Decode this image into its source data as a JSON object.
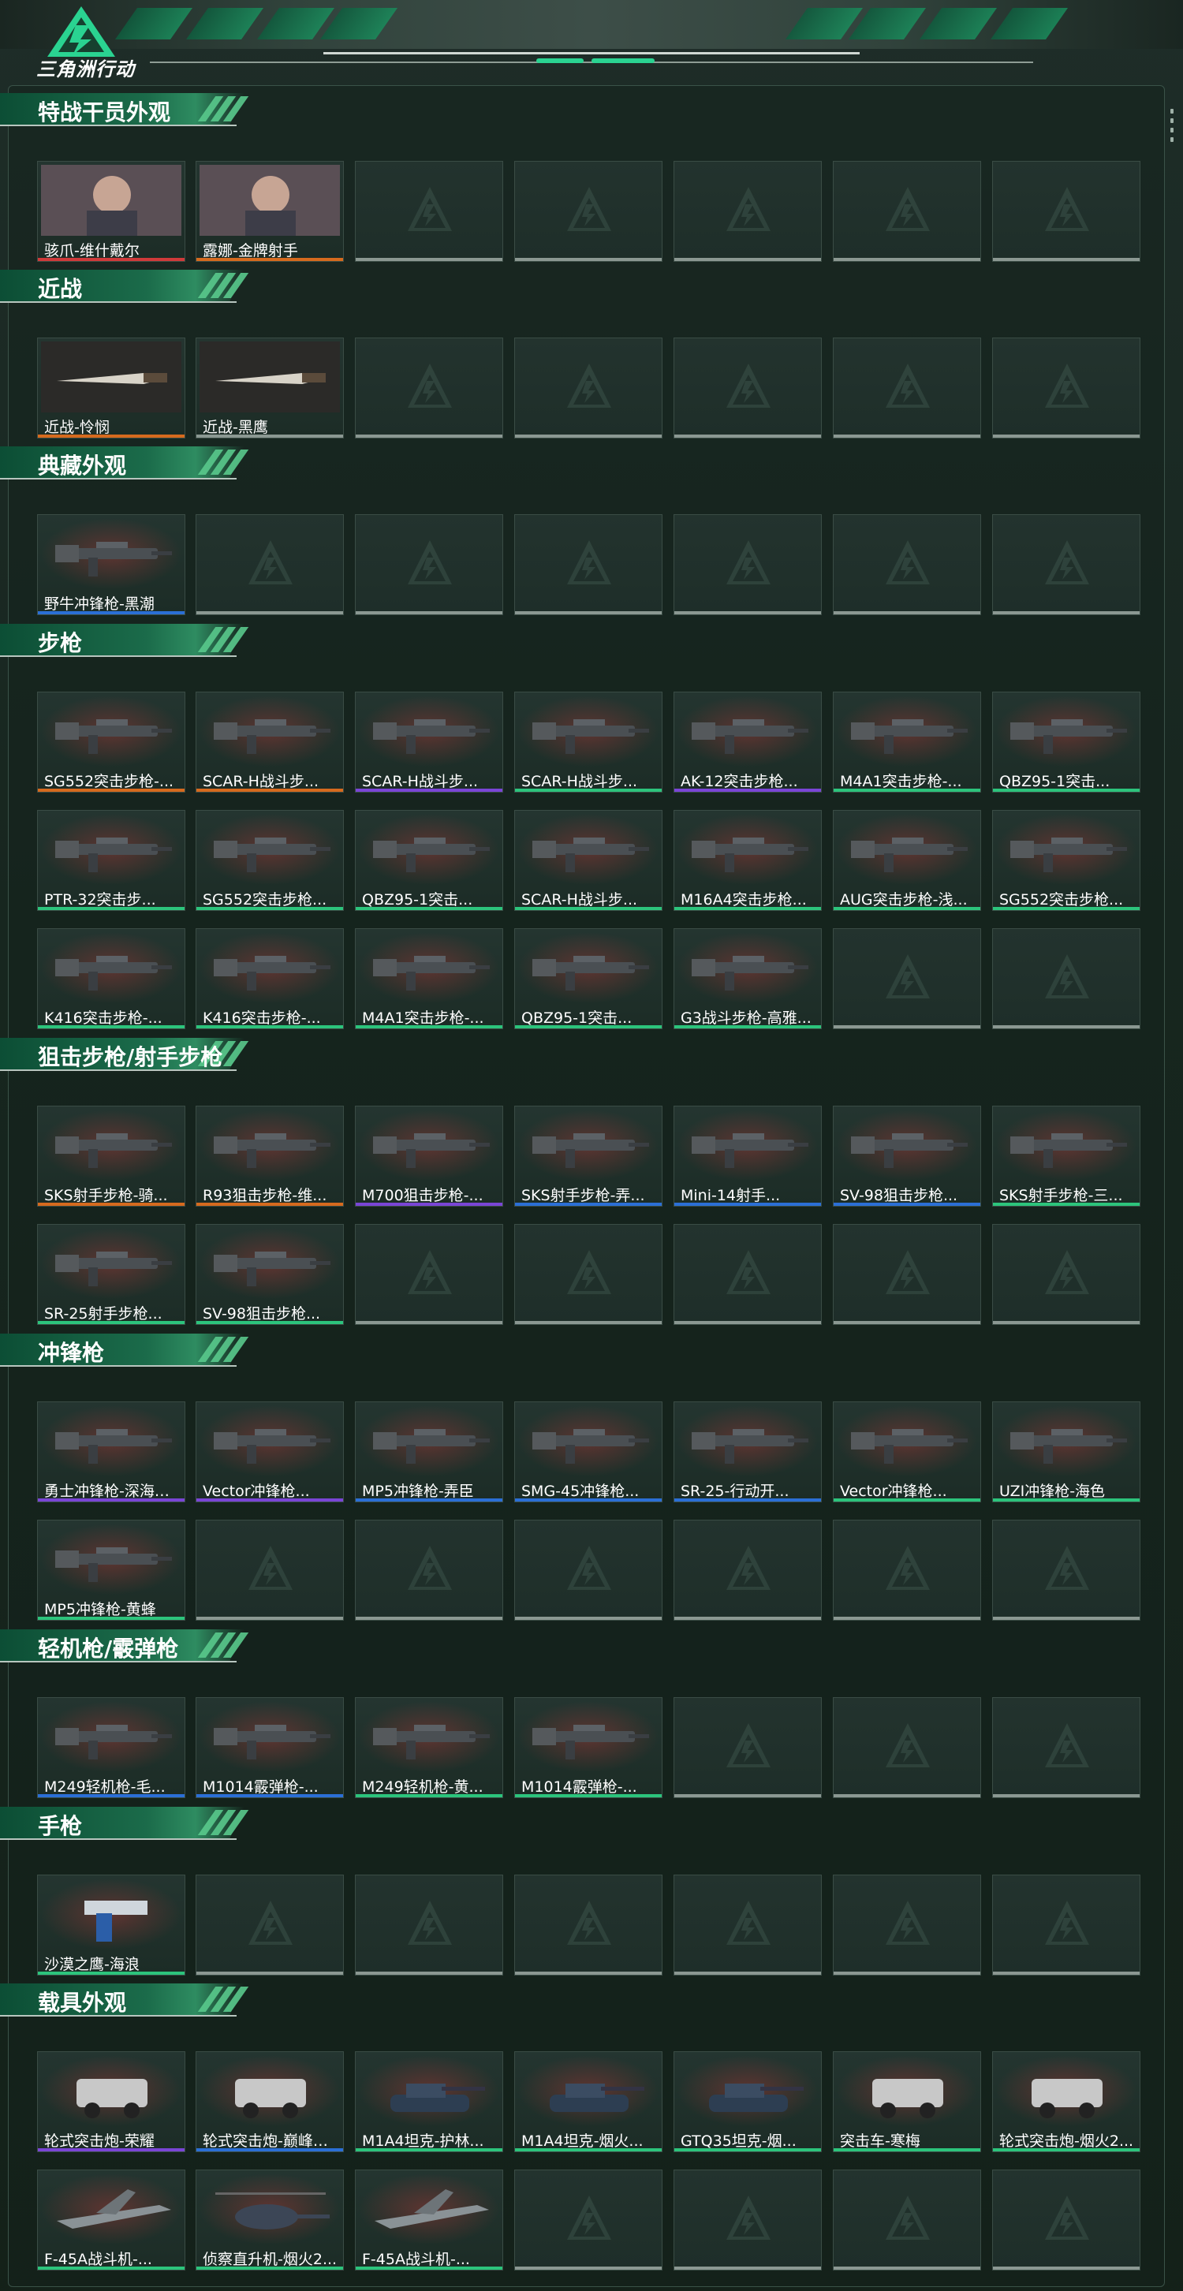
{
  "app": {
    "brand": "三角洲行动"
  },
  "colors": {
    "accent": "#2ad391",
    "orange": "#d66a1e",
    "purple": "#7a45d6",
    "blue": "#2b6fd6",
    "green": "#2cc47c",
    "gray": "#8b9892",
    "red": "#d03a3a"
  },
  "sections": [
    {
      "title": "特战干员外观",
      "items": [
        {
          "label": "骇爪-维什戴尔",
          "rarity": "red",
          "icon": "operator-portrait-icon"
        },
        {
          "label": "露娜-金牌射手",
          "rarity": "orange",
          "icon": "operator-portrait-icon"
        },
        null,
        null,
        null,
        null,
        null
      ]
    },
    {
      "title": "近战",
      "items": [
        {
          "label": "近战-怜悯",
          "rarity": "orange",
          "icon": "knife-icon"
        },
        {
          "label": "近战-黑鹰",
          "rarity": "gray",
          "icon": "knife-icon"
        },
        null,
        null,
        null,
        null,
        null
      ]
    },
    {
      "title": "典藏外观",
      "items": [
        {
          "label": "野牛冲锋枪-黑潮",
          "rarity": "blue",
          "icon": "smg-icon"
        },
        null,
        null,
        null,
        null,
        null,
        null
      ]
    },
    {
      "title": "步枪",
      "items": [
        {
          "label": "SG552突击步枪-...",
          "rarity": "orange",
          "icon": "rifle-icon"
        },
        {
          "label": "SCAR-H战斗步...",
          "rarity": "orange",
          "icon": "rifle-icon"
        },
        {
          "label": "SCAR-H战斗步...",
          "rarity": "purple",
          "icon": "rifle-icon"
        },
        {
          "label": "SCAR-H战斗步...",
          "rarity": "green",
          "icon": "rifle-icon"
        },
        {
          "label": "AK-12突击步枪...",
          "rarity": "purple",
          "icon": "rifle-icon"
        },
        {
          "label": "M4A1突击步枪-...",
          "rarity": "green",
          "icon": "rifle-icon"
        },
        {
          "label": "QBZ95-1突击...",
          "rarity": "green",
          "icon": "rifle-icon"
        },
        {
          "label": "PTR-32突击步...",
          "rarity": "green",
          "icon": "rifle-icon"
        },
        {
          "label": "SG552突击步枪...",
          "rarity": "green",
          "icon": "rifle-icon"
        },
        {
          "label": "QBZ95-1突击...",
          "rarity": "green",
          "icon": "rifle-icon"
        },
        {
          "label": "SCAR-H战斗步...",
          "rarity": "green",
          "icon": "rifle-icon"
        },
        {
          "label": "M16A4突击步枪...",
          "rarity": "green",
          "icon": "rifle-icon"
        },
        {
          "label": "AUG突击步枪-浅...",
          "rarity": "green",
          "icon": "rifle-icon"
        },
        {
          "label": "SG552突击步枪...",
          "rarity": "green",
          "icon": "rifle-icon"
        },
        {
          "label": "K416突击步枪-...",
          "rarity": "green",
          "icon": "rifle-icon"
        },
        {
          "label": "K416突击步枪-...",
          "rarity": "green",
          "icon": "rifle-icon"
        },
        {
          "label": "M4A1突击步枪-...",
          "rarity": "green",
          "icon": "rifle-icon"
        },
        {
          "label": "QBZ95-1突击...",
          "rarity": "green",
          "icon": "rifle-icon"
        },
        {
          "label": "G3战斗步枪-高雅...",
          "rarity": "green",
          "icon": "rifle-icon"
        },
        null,
        null
      ]
    },
    {
      "title": "狙击步枪/射手步枪",
      "items": [
        {
          "label": "SKS射手步枪-骑...",
          "rarity": "orange",
          "icon": "sniper-icon"
        },
        {
          "label": "R93狙击步枪-维...",
          "rarity": "orange",
          "icon": "sniper-icon"
        },
        {
          "label": "M700狙击步枪-...",
          "rarity": "purple",
          "icon": "sniper-icon"
        },
        {
          "label": "SKS射手步枪-弄...",
          "rarity": "blue",
          "icon": "sniper-icon"
        },
        {
          "label": "Mini-14射手...",
          "rarity": "blue",
          "icon": "sniper-icon"
        },
        {
          "label": "SV-98狙击步枪...",
          "rarity": "blue",
          "icon": "sniper-icon"
        },
        {
          "label": "SKS射手步枪-三...",
          "rarity": "green",
          "icon": "sniper-icon"
        },
        {
          "label": "SR-25射手步枪...",
          "rarity": "green",
          "icon": "sniper-icon"
        },
        {
          "label": "SV-98狙击步枪...",
          "rarity": "green",
          "icon": "sniper-icon"
        },
        null,
        null,
        null,
        null,
        null
      ]
    },
    {
      "title": "冲锋枪",
      "items": [
        {
          "label": "勇士冲锋枪-深海恐...",
          "rarity": "purple",
          "icon": "smg-icon"
        },
        {
          "label": "Vector冲锋枪...",
          "rarity": "purple",
          "icon": "smg-icon"
        },
        {
          "label": "MP5冲锋枪-弄臣",
          "rarity": "blue",
          "icon": "smg-icon"
        },
        {
          "label": "SMG-45冲锋枪...",
          "rarity": "blue",
          "icon": "smg-icon"
        },
        {
          "label": "SR-25-行动开...",
          "rarity": "blue",
          "icon": "smg-icon"
        },
        {
          "label": "Vector冲锋枪...",
          "rarity": "green",
          "icon": "smg-icon"
        },
        {
          "label": "UZI冲锋枪-海色",
          "rarity": "green",
          "icon": "smg-icon"
        },
        {
          "label": "MP5冲锋枪-黄蜂",
          "rarity": "green",
          "icon": "smg-icon"
        },
        null,
        null,
        null,
        null,
        null,
        null
      ]
    },
    {
      "title": "轻机枪/霰弹枪",
      "items": [
        {
          "label": "M249轻机枪-毛...",
          "rarity": "blue",
          "icon": "lmg-icon"
        },
        {
          "label": "M1014霰弹枪-...",
          "rarity": "blue",
          "icon": "shotgun-icon"
        },
        {
          "label": "M249轻机枪-黄...",
          "rarity": "green",
          "icon": "lmg-icon"
        },
        {
          "label": "M1014霰弹枪-...",
          "rarity": "green",
          "icon": "shotgun-icon"
        },
        null,
        null,
        null
      ]
    },
    {
      "title": "手枪",
      "items": [
        {
          "label": "沙漠之鹰-海浪",
          "rarity": "green",
          "icon": "pistol-icon"
        },
        null,
        null,
        null,
        null,
        null,
        null
      ]
    },
    {
      "title": "载具外观",
      "items": [
        {
          "label": "轮式突击炮-荣耀",
          "rarity": "purple",
          "icon": "armored-car-icon"
        },
        {
          "label": "轮式突击炮-巅峰竞...",
          "rarity": "blue",
          "icon": "armored-car-icon"
        },
        {
          "label": "M1A4坦克-护林...",
          "rarity": "green",
          "icon": "tank-icon"
        },
        {
          "label": "M1A4坦克-烟火...",
          "rarity": "green",
          "icon": "tank-icon"
        },
        {
          "label": "GTQ35坦克-烟...",
          "rarity": "green",
          "icon": "tank-icon"
        },
        {
          "label": "突击车-寒梅",
          "rarity": "green",
          "icon": "armored-car-icon"
        },
        {
          "label": "轮式突击炮-烟火2...",
          "rarity": "green",
          "icon": "armored-car-icon"
        },
        {
          "label": "F-45A战斗机-...",
          "rarity": "green",
          "icon": "jet-icon"
        },
        {
          "label": "侦察直升机-烟火2...",
          "rarity": "green",
          "icon": "helicopter-icon"
        },
        {
          "label": "F-45A战斗机-...",
          "rarity": "green",
          "icon": "jet-icon"
        },
        null,
        null,
        null,
        null
      ]
    }
  ]
}
